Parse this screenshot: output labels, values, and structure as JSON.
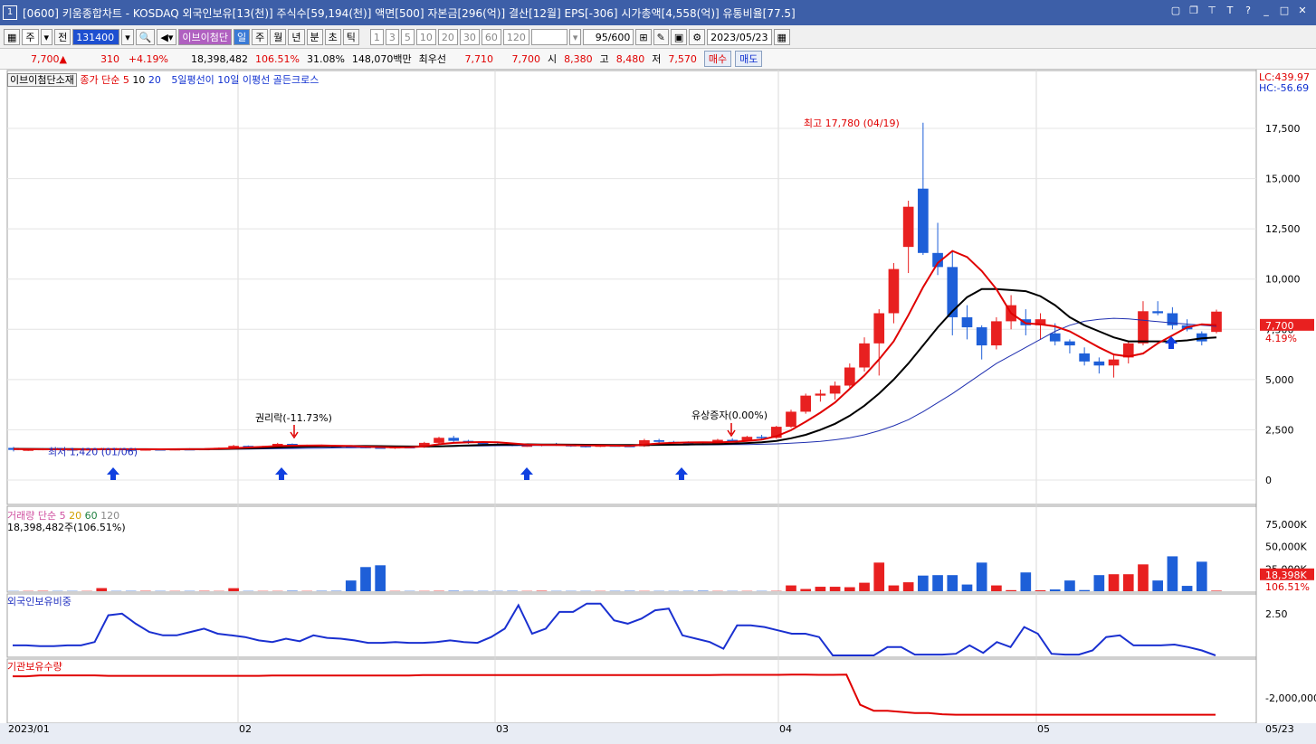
{
  "window": {
    "number": "1",
    "title": "[0600] 키움종합차트 - KOSDAQ 외국인보유[13(천)] 주식수[59,194(천)] 액면[500] 자본금[296(억)] 결산[12월] EPS[-306] 시가총액[4,558(억)] 유통비율[77.5]"
  },
  "toolbar": {
    "period_type": "주",
    "all_label": "전",
    "code": "131400",
    "stock_name": "이브이첨단",
    "intervals": [
      "일",
      "주",
      "월",
      "년",
      "분",
      "초",
      "틱"
    ],
    "active_interval": "일",
    "numbers": [
      "1",
      "3",
      "5",
      "10",
      "20",
      "30",
      "60",
      "120"
    ],
    "count": "95/600",
    "date": "2023/05/23"
  },
  "infobar": {
    "price": "7,700",
    "arrow": "▲",
    "change": "310",
    "change_pct": "+4.19%",
    "volume": "18,398,482",
    "vol_ratio": "106.51%",
    "turnover": "31.08%",
    "amount": "148,070백만",
    "best_label": "최우선",
    "ask": "7,710",
    "bid": "7,700",
    "open_label": "시",
    "open": "8,380",
    "high_label": "고",
    "high": "8,480",
    "low_label": "저",
    "low": "7,570",
    "buy_button": "매수",
    "sell_button": "매도"
  },
  "legends": {
    "main_tag": "이브이첨단소재",
    "ma_title": "종가 단순",
    "ma_periods": [
      "5",
      "10",
      "20"
    ],
    "signal": "5일평선이 10일 이평선 골든크로스",
    "lc": "LC:439.97",
    "hc": "HC:-56.69",
    "high_annot": "최고 17,780 (04/19)",
    "low_annot": "최저 1,420 (01/06)",
    "event1": "권리락(-11.73%)",
    "event2": "유상증자(0.00%)",
    "cur_price": "7,700",
    "cur_pct": "4.19%",
    "vol_title": "거래량",
    "vol_ma_title": "단순",
    "vol_ma_periods": [
      "5",
      "20",
      "60",
      "120"
    ],
    "vol_value": "18,398,482주(106.51%)",
    "vol_cur": "18,398K",
    "vol_pct": "106.51%",
    "foreign_title": "외국인보유비중",
    "inst_title": "기관보유수량"
  },
  "colors": {
    "up": "#e82020",
    "down": "#1e5fd8",
    "ma5": "#e00000",
    "ma10": "#000000",
    "ma20": "#2030b0",
    "title_bg": "#3d5fa8"
  },
  "axes": {
    "price_ticks": [
      "17,500",
      "15,000",
      "12,500",
      "10,000",
      "7,500",
      "5,000",
      "2,500",
      "0"
    ],
    "price_tick_values": [
      17500,
      15000,
      12500,
      10000,
      7500,
      5000,
      2500,
      0
    ],
    "volume_ticks": [
      "75,000K",
      "50,000K",
      "25,000K"
    ],
    "volume_tick_values": [
      75000,
      50000,
      25000
    ],
    "foreign_ticks": [
      "2.50"
    ],
    "foreign_tick_values": [
      2.5
    ],
    "inst_ticks": [
      "-2,000,000"
    ],
    "inst_tick_values": [
      -2000000
    ],
    "x_labels": [
      "2023/01",
      "02",
      "03",
      "04",
      "05",
      "05/23"
    ]
  },
  "chart_data": {
    "type": "candlestick",
    "note": "",
    "candles": [
      [
        1600,
        1650,
        1420,
        1500
      ],
      [
        1500,
        1560,
        1450,
        1520
      ],
      [
        1520,
        1580,
        1480,
        1550
      ],
      [
        1550,
        1600,
        1500,
        1530
      ],
      [
        1530,
        1570,
        1490,
        1510
      ],
      [
        1510,
        1550,
        1470,
        1540
      ],
      [
        1540,
        1600,
        1500,
        1560
      ],
      [
        1560,
        1590,
        1500,
        1520
      ],
      [
        1520,
        1560,
        1480,
        1500
      ],
      [
        1500,
        1540,
        1460,
        1530
      ],
      [
        1530,
        1570,
        1490,
        1510
      ],
      [
        1510,
        1560,
        1480,
        1540
      ],
      [
        1540,
        1580,
        1500,
        1520
      ],
      [
        1520,
        1560,
        1490,
        1550
      ],
      [
        1550,
        1620,
        1510,
        1600
      ],
      [
        1600,
        1750,
        1560,
        1700
      ],
      [
        1700,
        1720,
        1600,
        1650
      ],
      [
        1650,
        1700,
        1600,
        1680
      ],
      [
        1680,
        1850,
        1650,
        1800
      ],
      [
        1800,
        1820,
        1680,
        1700
      ],
      [
        1700,
        1760,
        1650,
        1720
      ],
      [
        1720,
        1760,
        1660,
        1690
      ],
      [
        1690,
        1720,
        1640,
        1660
      ],
      [
        1660,
        1700,
        1600,
        1650
      ],
      [
        1650,
        1690,
        1580,
        1620
      ],
      [
        1620,
        1660,
        1560,
        1600
      ],
      [
        1600,
        1650,
        1550,
        1640
      ],
      [
        1640,
        1700,
        1600,
        1620
      ],
      [
        1620,
        1900,
        1600,
        1850
      ],
      [
        1850,
        2150,
        1800,
        2100
      ],
      [
        2100,
        2200,
        1900,
        1950
      ],
      [
        1950,
        2000,
        1800,
        1850
      ],
      [
        1850,
        1900,
        1750,
        1800
      ],
      [
        1800,
        1850,
        1700,
        1780
      ],
      [
        1780,
        1820,
        1680,
        1700
      ],
      [
        1700,
        1760,
        1650,
        1720
      ],
      [
        1720,
        1800,
        1680,
        1780
      ],
      [
        1780,
        1850,
        1700,
        1740
      ],
      [
        1740,
        1780,
        1650,
        1700
      ],
      [
        1700,
        1750,
        1620,
        1680
      ],
      [
        1680,
        1740,
        1640,
        1720
      ],
      [
        1720,
        1760,
        1660,
        1700
      ],
      [
        1700,
        1740,
        1650,
        1680
      ],
      [
        1680,
        2050,
        1650,
        1980
      ],
      [
        1980,
        2050,
        1850,
        1900
      ],
      [
        1900,
        1950,
        1820,
        1870
      ],
      [
        1870,
        1920,
        1780,
        1820
      ],
      [
        1820,
        1860,
        1740,
        1800
      ],
      [
        1800,
        2050,
        1780,
        2000
      ],
      [
        2000,
        2080,
        1900,
        1950
      ],
      [
        1950,
        2200,
        1920,
        2150
      ],
      [
        2150,
        2250,
        2000,
        2100
      ],
      [
        2100,
        2700,
        2050,
        2650
      ],
      [
        2650,
        3500,
        2600,
        3400
      ],
      [
        3400,
        4300,
        3300,
        4200
      ],
      [
        4200,
        4500,
        3900,
        4300
      ],
      [
        4300,
        4900,
        4000,
        4700
      ],
      [
        4700,
        5800,
        4600,
        5600
      ],
      [
        5600,
        7100,
        5400,
        6800
      ],
      [
        6800,
        8500,
        5200,
        8300
      ],
      [
        8300,
        10800,
        7800,
        10500
      ],
      [
        11600,
        13900,
        10300,
        13600
      ],
      [
        14500,
        17780,
        11200,
        11300
      ],
      [
        11300,
        12800,
        10200,
        10600
      ],
      [
        10600,
        11400,
        7200,
        8100
      ],
      [
        8100,
        8700,
        7000,
        7600
      ],
      [
        7600,
        7700,
        6000,
        6700
      ],
      [
        6700,
        8100,
        6500,
        7900
      ],
      [
        7900,
        9200,
        7500,
        8700
      ],
      [
        8000,
        8500,
        7200,
        7700
      ],
      [
        7700,
        8300,
        7000,
        8000
      ],
      [
        7300,
        7800,
        6700,
        6900
      ],
      [
        6900,
        7000,
        6300,
        6700
      ],
      [
        6300,
        6600,
        5700,
        5900
      ],
      [
        5900,
        6100,
        5300,
        5700
      ],
      [
        5700,
        6300,
        5100,
        6000
      ],
      [
        6100,
        6900,
        5800,
        6800
      ],
      [
        6800,
        8900,
        6700,
        8400
      ],
      [
        8400,
        8900,
        8200,
        8300
      ],
      [
        8300,
        8600,
        7500,
        7700
      ],
      [
        7700,
        8000,
        7400,
        7500
      ],
      [
        7300,
        7400,
        6700,
        6900
      ],
      [
        7370,
        8480,
        7300,
        8380
      ]
    ],
    "candle_slots": [
      0,
      1,
      2,
      3,
      4,
      5,
      6,
      7,
      8,
      9,
      10,
      11,
      12,
      13,
      14,
      15,
      16,
      17,
      18,
      19,
      20,
      21,
      22,
      23,
      24,
      25,
      26,
      27,
      28,
      29,
      30,
      31,
      32,
      33,
      34,
      35,
      36,
      37,
      38,
      39,
      40,
      41,
      42,
      43,
      44,
      45,
      46,
      47,
      48,
      49,
      50,
      51,
      52,
      53,
      54,
      55,
      56,
      57,
      58,
      59,
      60,
      61,
      62,
      63,
      64,
      65,
      66,
      67,
      68,
      69,
      70,
      71,
      72,
      73,
      74,
      75,
      76,
      77,
      78,
      79,
      80,
      81,
      82
    ],
    "ma5": [
      1540,
      1535,
      1530,
      1528,
      1525,
      1530,
      1535,
      1533,
      1530,
      1528,
      1530,
      1532,
      1535,
      1540,
      1560,
      1590,
      1620,
      1650,
      1690,
      1710,
      1715,
      1720,
      1705,
      1690,
      1660,
      1640,
      1625,
      1630,
      1680,
      1780,
      1850,
      1880,
      1890,
      1880,
      1820,
      1770,
      1750,
      1740,
      1730,
      1720,
      1720,
      1710,
      1700,
      1760,
      1820,
      1850,
      1870,
      1880,
      1870,
      1900,
      1950,
      2010,
      2180,
      2480,
      2900,
      3350,
      3860,
      4540,
      5200,
      6000,
      6900,
      8200,
      9600,
      10800,
      11400,
      11100,
      10400,
      9500,
      8300,
      7800,
      7750,
      7650,
      7400,
      7000,
      6600,
      6250,
      6150,
      6300,
      6800,
      7200,
      7600,
      7750,
      7700
    ],
    "ma10": [
      1550,
      1548,
      1545,
      1540,
      1538,
      1536,
      1535,
      1534,
      1533,
      1532,
      1531,
      1531,
      1532,
      1534,
      1540,
      1555,
      1575,
      1595,
      1620,
      1640,
      1660,
      1670,
      1680,
      1690,
      1690,
      1685,
      1675,
      1670,
      1670,
      1680,
      1700,
      1720,
      1740,
      1760,
      1770,
      1775,
      1770,
      1765,
      1760,
      1755,
      1750,
      1745,
      1740,
      1745,
      1750,
      1760,
      1770,
      1780,
      1790,
      1810,
      1840,
      1880,
      1950,
      2080,
      2250,
      2500,
      2800,
      3200,
      3700,
      4300,
      5000,
      5800,
      6700,
      7600,
      8400,
      9100,
      9500,
      9500,
      9450,
      9400,
      9150,
      8700,
      8100,
      7700,
      7400,
      7100,
      6900,
      6900,
      6900,
      6900,
      6950,
      7050,
      7100
    ],
    "ma20": [
      1560,
      1558,
      1556,
      1554,
      1552,
      1550,
      1548,
      1546,
      1544,
      1542,
      1540,
      1539,
      1538,
      1537,
      1538,
      1540,
      1545,
      1550,
      1560,
      1570,
      1580,
      1590,
      1600,
      1610,
      1620,
      1630,
      1640,
      1650,
      1660,
      1670,
      1680,
      1690,
      1700,
      1710,
      1715,
      1720,
      1725,
      1728,
      1730,
      1732,
      1734,
      1736,
      1738,
      1740,
      1742,
      1745,
      1748,
      1752,
      1756,
      1762,
      1770,
      1780,
      1800,
      1830,
      1870,
      1920,
      2000,
      2100,
      2250,
      2450,
      2700,
      3000,
      3400,
      3850,
      4300,
      4800,
      5300,
      5800,
      6200,
      6600,
      7000,
      7400,
      7700,
      7900,
      8000,
      8050,
      8020,
      7950,
      7880,
      7820,
      7760,
      7700,
      7650
    ],
    "volume": [
      500,
      900,
      400,
      300,
      400,
      350,
      300,
      6000,
      500,
      450,
      400,
      300,
      350,
      400,
      500,
      450,
      350,
      300,
      400,
      350,
      300,
      300,
      250,
      300,
      500,
      3500,
      400,
      450,
      300,
      300,
      300,
      250,
      300,
      300,
      350,
      3000,
      300,
      400,
      350,
      250,
      300,
      400,
      300,
      300,
      300,
      3500,
      300,
      350,
      400,
      300,
      300,
      300,
      400,
      300,
      3400,
      300,
      300,
      300,
      500,
      300,
      400,
      400,
      12000,
      27000,
      29000,
      300,
      300,
      300,
      400,
      500,
      300,
      300,
      300,
      400,
      300,
      500,
      300,
      300,
      300,
      300,
      350,
      400,
      300,
      300,
      300,
      350,
      500,
      300,
      300,
      300,
      300,
      350,
      6500,
      2500,
      5000,
      5000,
      4500,
      9500,
      32000,
      6500,
      10000,
      17500,
      18000,
      18000,
      7500,
      32000,
      6500,
      1200,
      21000,
      1000,
      2000,
      12000,
      1300,
      18000,
      19000,
      19000,
      30000,
      12000,
      39000,
      6000,
      33000,
      600
    ],
    "foreign_pct": [
      0.6,
      0.6,
      0.55,
      0.55,
      0.6,
      0.6,
      0.8,
      2.4,
      2.5,
      1.9,
      1.4,
      1.2,
      1.2,
      1.4,
      1.6,
      1.3,
      1.2,
      1.1,
      0.9,
      0.8,
      1.0,
      0.85,
      1.2,
      1.05,
      1.0,
      0.9,
      0.75,
      0.75,
      0.8,
      0.75,
      0.75,
      0.8,
      0.9,
      0.8,
      0.75,
      1.1,
      1.6,
      3.0,
      1.3,
      1.6,
      2.6,
      2.6,
      3.1,
      3.1,
      2.1,
      1.9,
      2.2,
      2.7,
      2.8,
      1.2,
      1.0,
      0.8,
      0.4,
      1.8,
      1.8,
      1.7,
      1.5,
      1.3,
      1.3,
      1.1,
      0.0,
      0.0,
      0.0,
      0.0,
      0.5,
      0.5,
      0.05,
      0.05,
      0.05,
      0.1,
      0.6,
      0.15,
      0.8,
      0.5,
      1.7,
      1.3,
      0.1,
      0.05,
      0.05,
      0.3,
      1.1,
      1.2,
      0.6,
      0.6,
      0.6,
      0.65,
      0.5,
      0.3,
      0.0
    ],
    "inst_qty": [
      -1100000,
      -1100000,
      -1060000,
      -1060000,
      -1060000,
      -1060000,
      -1060000,
      -1080000,
      -1080000,
      -1080000,
      -1080000,
      -1080000,
      -1080000,
      -1080000,
      -1080000,
      -1080000,
      -1080000,
      -1080000,
      -1080000,
      -1070000,
      -1070000,
      -1070000,
      -1070000,
      -1070000,
      -1070000,
      -1070000,
      -1070000,
      -1070000,
      -1070000,
      -1070000,
      -1050000,
      -1050000,
      -1050000,
      -1050000,
      -1050000,
      -1050000,
      -1050000,
      -1050000,
      -1050000,
      -1050000,
      -1050000,
      -1050000,
      -1050000,
      -1050000,
      -1050000,
      -1050000,
      -1050000,
      -1050000,
      -1050000,
      -1050000,
      -1050000,
      -1050000,
      -1040000,
      -1040000,
      -1040000,
      -1040000,
      -1040000,
      -1030000,
      -1030000,
      -1040000,
      -1040000,
      -1030000,
      -2300000,
      -2550000,
      -2550000,
      -2600000,
      -2650000,
      -2650000,
      -2700000,
      -2720000,
      -2720000,
      -2720000,
      -2720000,
      -2720000,
      -2720000,
      -2720000,
      -2720000,
      -2720000,
      -2720000,
      -2720000,
      -2720000,
      -2720000,
      -2720000,
      -2720000,
      -2720000,
      -2720000,
      -2720000,
      -2720000,
      -2720000
    ]
  }
}
